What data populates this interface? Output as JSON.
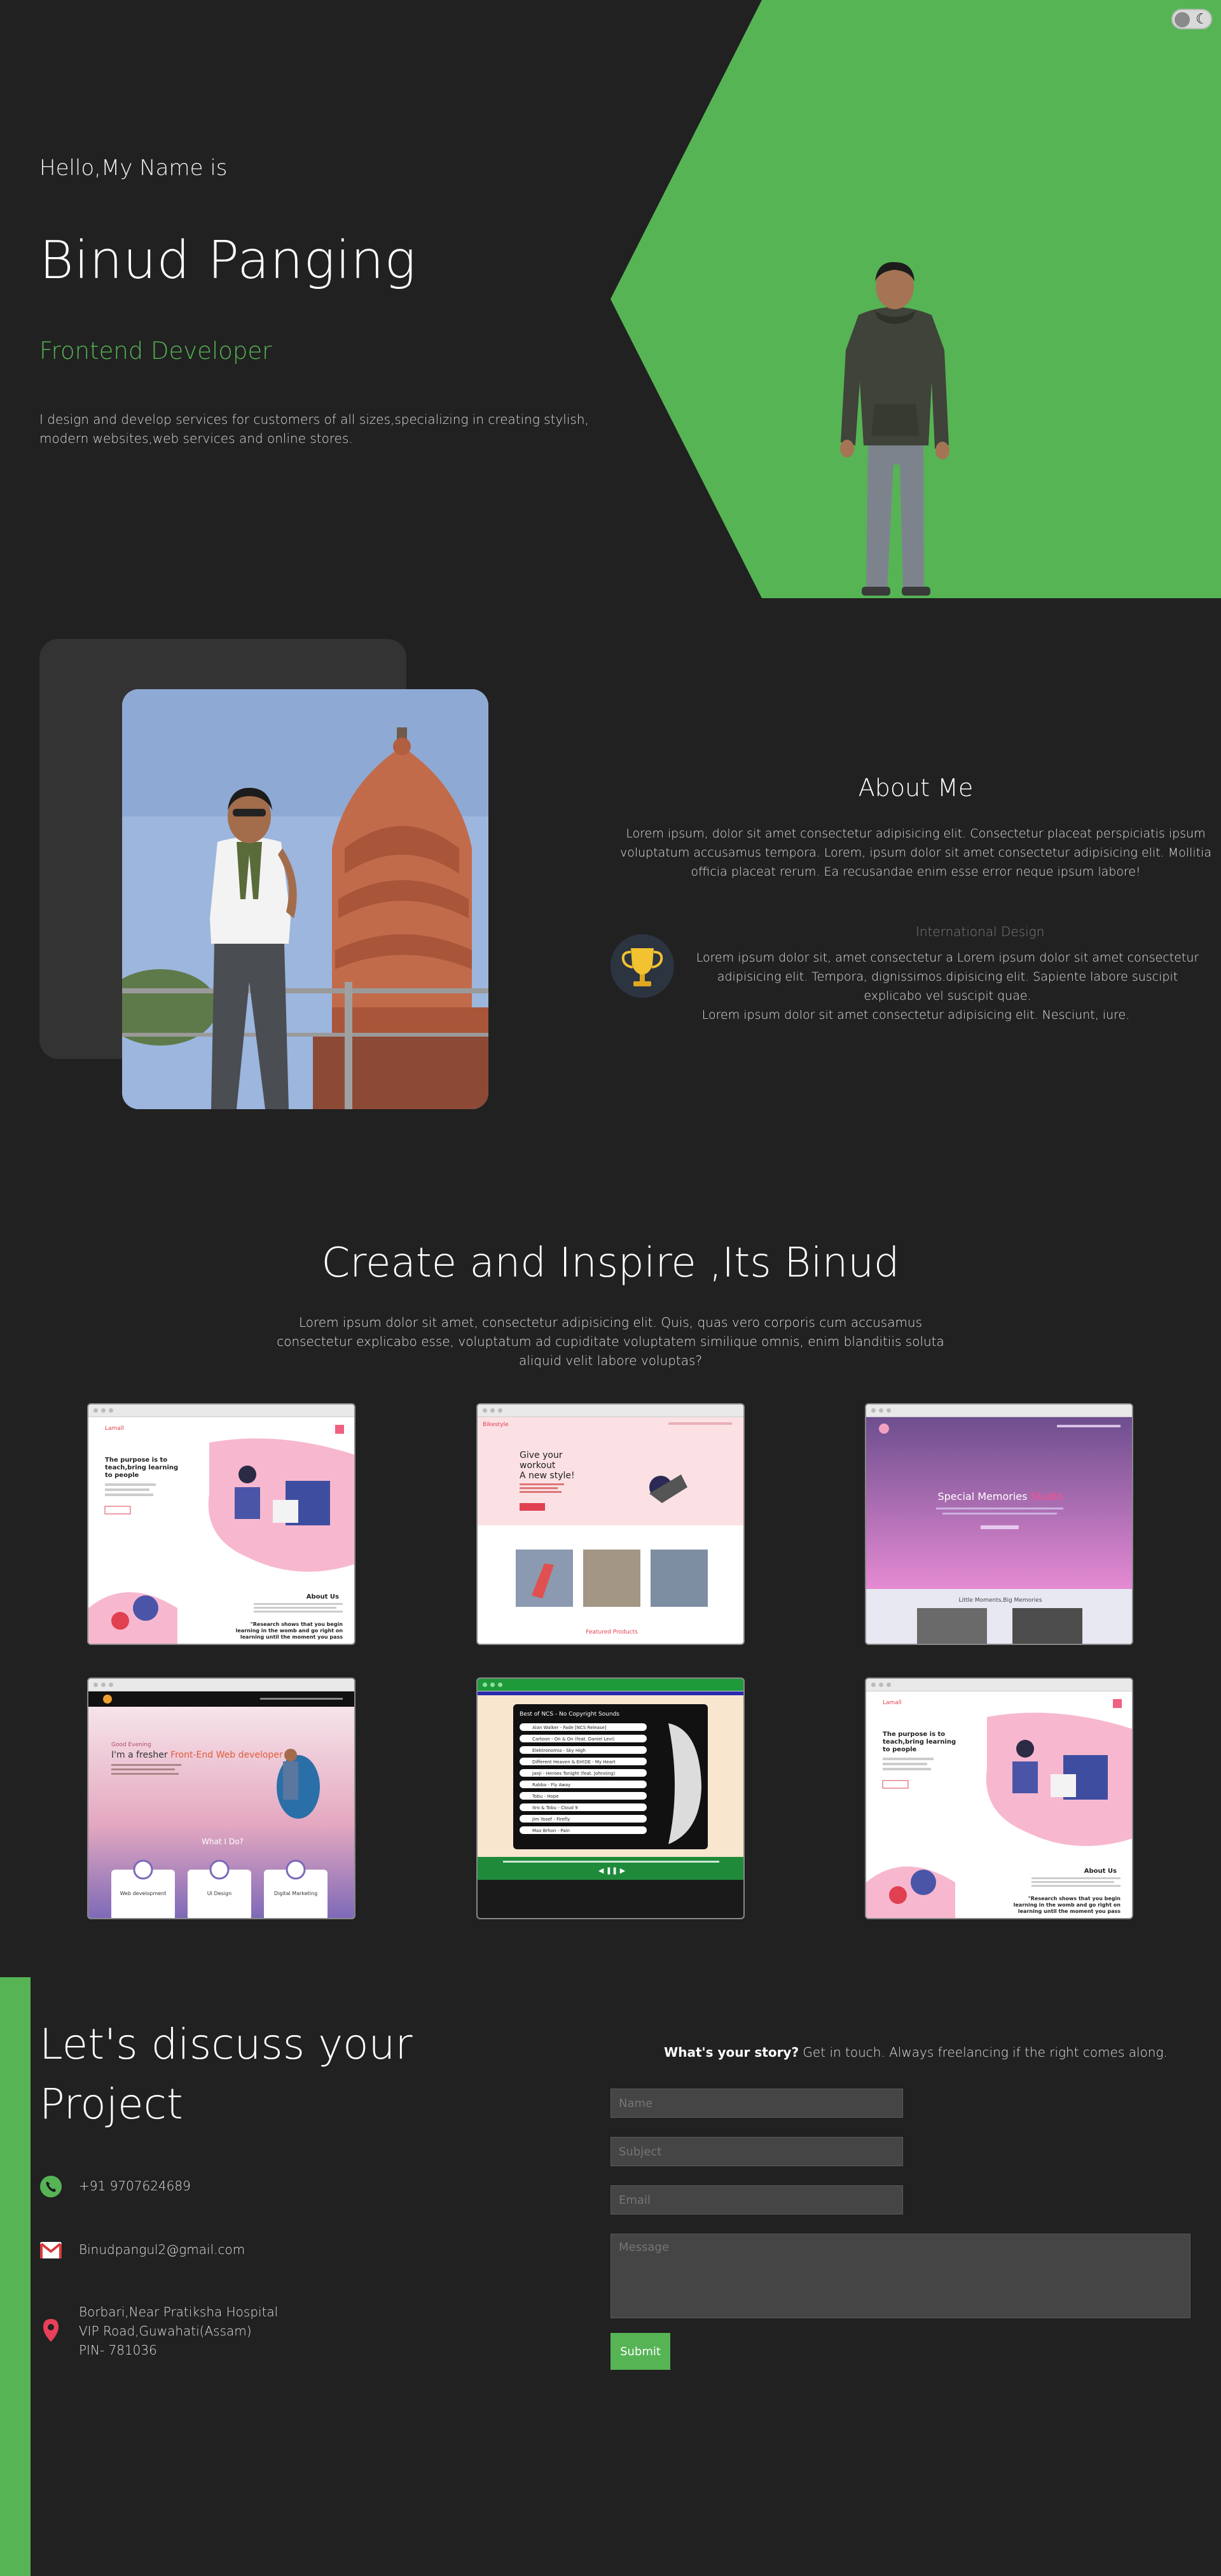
{
  "theme": {
    "accent": "#56b455",
    "background": "#212121",
    "card": "#333333"
  },
  "hero": {
    "greeting": "Hello,My Name is",
    "name": "Binud Panging",
    "role": "Frontend Developer",
    "intro": "I design and develop services for customers of all sizes,specializing in creating stylish, modern websites,web services and online stores."
  },
  "theme_toggle": {
    "icon": "moon-icon"
  },
  "about": {
    "title": "About Me",
    "text": "Lorem ipsum, dolor sit amet consectetur adipisicing elit. Consectetur placeat perspiciatis ipsum voluptatum accusamus tempora. Lorem, ipsum dolor sit amet consectetur adipisicing elit. Mollitia officia placeat rerum. Ea recusandae enim esse error neque ipsum labore!",
    "award_heading": "International Design",
    "award_text": "Lorem ipsum dolor sit, amet consectetur a Lorem ipsum dolor sit amet consectetur adipisicing elit. Tempora, dignissimos.dipisicing elit. Sapiente labore suscipit explicabo vel suscipit quae.",
    "award_text2": "Lorem ipsum dolor sit amet consectetur adipisicing elit. Nesciunt, iure.",
    "award_icon": "trophy-icon"
  },
  "projects": {
    "title": "Create and Inspire ,Its Binud",
    "text": "Lorem ipsum dolor sit amet, consectetur adipisicing elit. Quis, quas vero corporis cum accusamus consectetur explicabo esse, voluptatum ad cupiditate voluptatem similique omnis, enim blanditiis soluta aliquid velit labore voluptas?",
    "cards": [
      {
        "brand": "Lamall",
        "headline": "The purpose is to teach,bring learning to people",
        "section": "About Us",
        "quote": "Research shows that you begin learning in the womb and go right on learning until the moment you pass on. Your brain has a capacity for"
      },
      {
        "brand": "Bikestyle",
        "headline": "Give your workout A new style!",
        "section": "Featured Products"
      },
      {
        "headline": "Special Memories Studio",
        "highlight": "Studio",
        "section": "Little Moments,Big Memories"
      },
      {
        "greeting": "Good Evening",
        "headline": "I'm a fresher Front-End Web developer",
        "highlight": "Front-End Web developer",
        "section": "What I Do?",
        "services": [
          "Web development",
          "UI Design",
          "Digital Marketing"
        ]
      },
      {
        "headline": "Best of NCS - No Copyright Sounds",
        "tracks": [
          "Alan Walker - Fade [NCS Release]",
          "Cartoon - On & On (feat. Daniel Levi)",
          "Elektronomia - Sky High",
          "Different Heaven & EH!DE - My Heart",
          "Janji - Heroes Tonight (feat. Johnning)",
          "Rabba - Fly Away",
          "Tobu - Hope",
          "Itro & Tobu - Cloud 9",
          "Jim Yosef - Firefly",
          "Max Brhon - Pain"
        ],
        "controls": "◀ ❚❚ ▶"
      },
      {
        "brand": "Lamall",
        "headline": "The purpose is to teach,bring learning to people",
        "section": "About Us",
        "quote": "Research shows that you begin learning in the womb and go right on learning until the moment you pass on. Your brain has a capacity for"
      }
    ]
  },
  "contact": {
    "title": "Let's discuss your Project",
    "phone": "+91 9707624689",
    "email": "Binudpangul2@gmail.com",
    "address": [
      "Borbari,Near Pratiksha Hospital",
      "VIP Road,Guwahati(Assam)",
      "PIN- 781036"
    ],
    "story_bold": "What's your story?",
    "story_rest": " Get in touch. Always freelancing if the right comes along.",
    "placeholders": {
      "name": "Name",
      "subject": "Subject",
      "email": "Email",
      "message": "Message"
    },
    "submit": "Submit"
  }
}
